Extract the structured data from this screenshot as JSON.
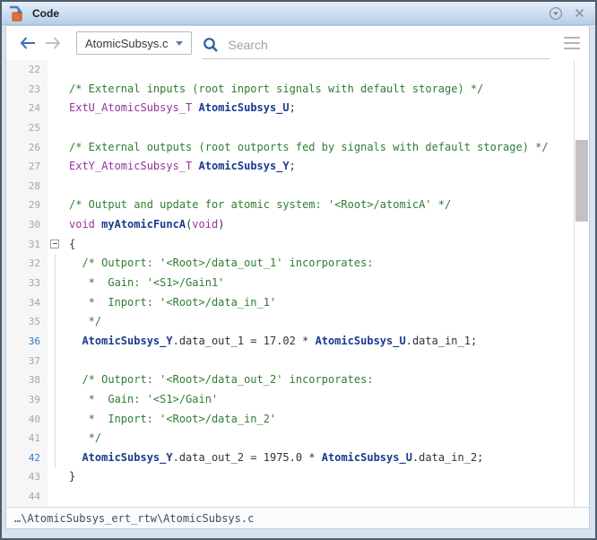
{
  "window": {
    "title": "Code"
  },
  "titlebar": {
    "icons": [
      "simulink-code-icon",
      "dock-options-icon",
      "close-icon"
    ]
  },
  "toolbar": {
    "back_icon": "arrow-left",
    "forward_icon": "arrow-right",
    "file_selector_value": "AtomicSubsys.c",
    "search_placeholder": "Search",
    "menu_icon": "hamburger"
  },
  "colors": {
    "titlebar_gradient_top": "#e4eefb",
    "titlebar_gradient_bottom": "#b4ceе9",
    "comment": "#2f7d31",
    "keyword": "#993399",
    "identifier_bold": "#1b3a8f",
    "active_line_number": "#2f7bc9",
    "accent_blue": "#3e6fae"
  },
  "editor": {
    "visible_line_range": [
      22,
      44
    ],
    "active_lines": [
      36,
      42
    ],
    "lines": [
      {
        "n": 22,
        "segs": []
      },
      {
        "n": 23,
        "segs": [
          [
            "cmt",
            "/* External inputs (root inport signals with default storage) */"
          ]
        ]
      },
      {
        "n": 24,
        "segs": [
          [
            "typ",
            "ExtU_AtomicSubsys_T"
          ],
          [
            "pl",
            " "
          ],
          [
            "glob",
            "AtomicSubsys_U"
          ],
          [
            "pl",
            ";"
          ]
        ]
      },
      {
        "n": 25,
        "segs": []
      },
      {
        "n": 26,
        "segs": [
          [
            "cmt",
            "/* External outputs (root outports fed by signals with default storage) */"
          ]
        ]
      },
      {
        "n": 27,
        "segs": [
          [
            "typ",
            "ExtY_AtomicSubsys_T"
          ],
          [
            "pl",
            " "
          ],
          [
            "glob",
            "AtomicSubsys_Y"
          ],
          [
            "pl",
            ";"
          ]
        ]
      },
      {
        "n": 28,
        "segs": []
      },
      {
        "n": 29,
        "segs": [
          [
            "cmt",
            "/* Output and update for atomic system: '<Root>/atomicA' */"
          ]
        ]
      },
      {
        "n": 30,
        "segs": [
          [
            "kw",
            "void"
          ],
          [
            "pl",
            " "
          ],
          [
            "fn",
            "myAtomicFuncA"
          ],
          [
            "pl",
            "("
          ],
          [
            "kw",
            "void"
          ],
          [
            "pl",
            ")"
          ]
        ]
      },
      {
        "n": 31,
        "fold": "box",
        "segs": [
          [
            "pl",
            "{"
          ]
        ]
      },
      {
        "n": 32,
        "fold": "line",
        "segs": [
          [
            "cmt",
            "  /* Outport: '<Root>/data_out_1' incorporates:"
          ]
        ]
      },
      {
        "n": 33,
        "fold": "line",
        "segs": [
          [
            "cmt",
            "   *  Gain: '<S1>/Gain1'"
          ]
        ]
      },
      {
        "n": 34,
        "fold": "line",
        "segs": [
          [
            "cmt",
            "   *  Inport: '<Root>/data_in_1'"
          ]
        ]
      },
      {
        "n": 35,
        "fold": "line",
        "segs": [
          [
            "cmt",
            "   */"
          ]
        ]
      },
      {
        "n": 36,
        "active": true,
        "fold": "line",
        "segs": [
          [
            "pl",
            "  "
          ],
          [
            "glob",
            "AtomicSubsys_Y"
          ],
          [
            "pl",
            ".data_out_1 = 17.02 * "
          ],
          [
            "glob",
            "AtomicSubsys_U"
          ],
          [
            "pl",
            ".data_in_1;"
          ]
        ]
      },
      {
        "n": 37,
        "fold": "line",
        "segs": []
      },
      {
        "n": 38,
        "fold": "line",
        "segs": [
          [
            "cmt",
            "  /* Outport: '<Root>/data_out_2' incorporates:"
          ]
        ]
      },
      {
        "n": 39,
        "fold": "line",
        "segs": [
          [
            "cmt",
            "   *  Gain: '<S1>/Gain'"
          ]
        ]
      },
      {
        "n": 40,
        "fold": "line",
        "segs": [
          [
            "cmt",
            "   *  Inport: '<Root>/data_in_2'"
          ]
        ]
      },
      {
        "n": 41,
        "fold": "line",
        "segs": [
          [
            "cmt",
            "   */"
          ]
        ]
      },
      {
        "n": 42,
        "active": true,
        "fold": "line",
        "segs": [
          [
            "pl",
            "  "
          ],
          [
            "glob",
            "AtomicSubsys_Y"
          ],
          [
            "pl",
            ".data_out_2 = 1975.0 * "
          ],
          [
            "glob",
            "AtomicSubsys_U"
          ],
          [
            "pl",
            ".data_in_2;"
          ]
        ]
      },
      {
        "n": 43,
        "segs": [
          [
            "pl",
            "}"
          ]
        ]
      },
      {
        "n": 44,
        "segs": []
      }
    ]
  },
  "statusbar": {
    "path": "…\\AtomicSubsys_ert_rtw\\AtomicSubsys.c"
  }
}
